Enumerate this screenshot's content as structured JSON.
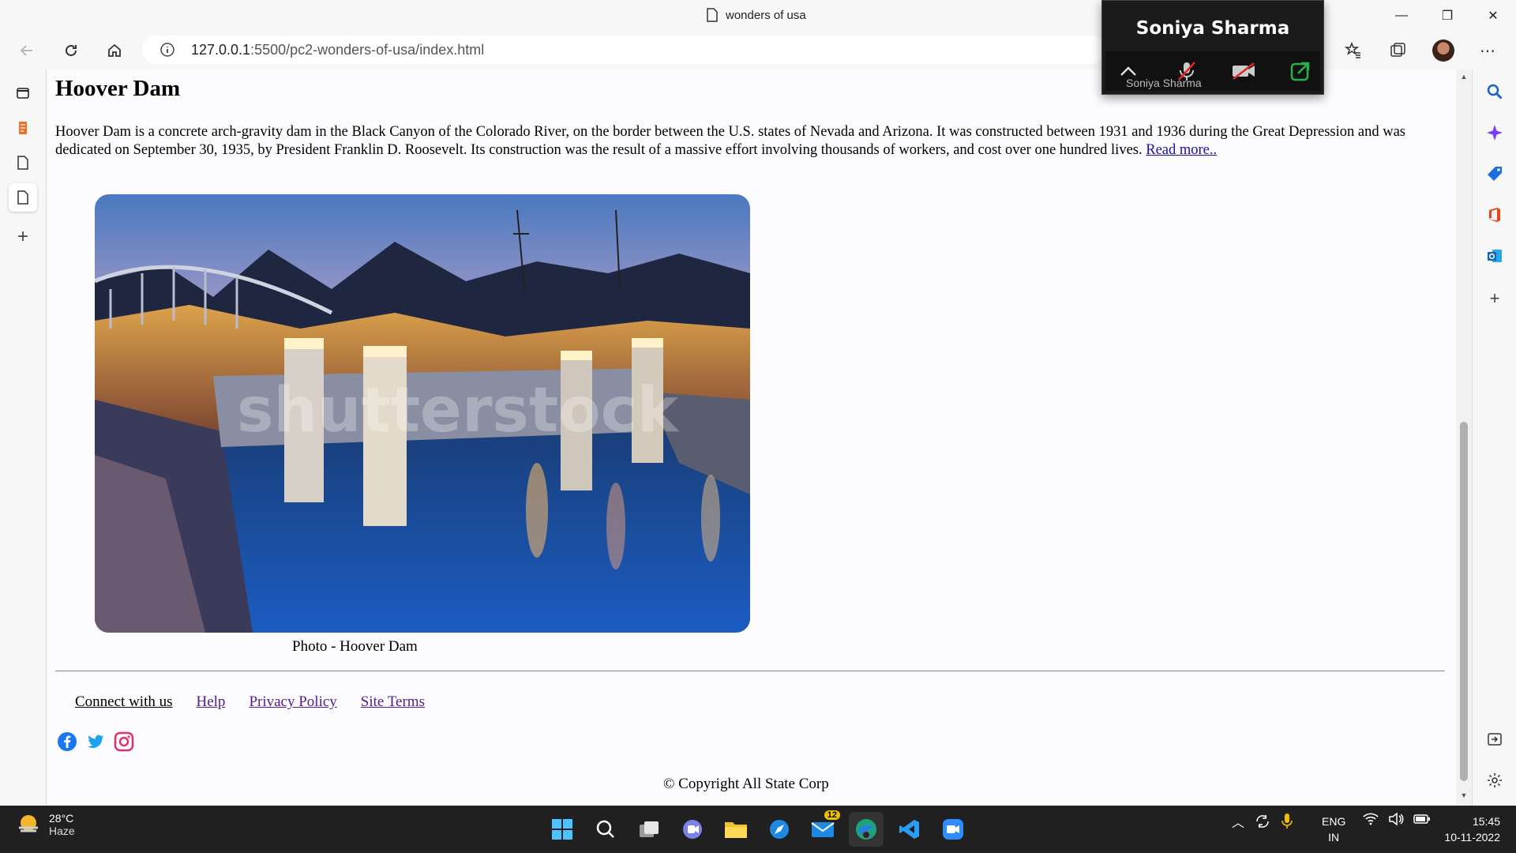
{
  "browser": {
    "tab_title": "wonders of usa",
    "url_host": "127.0.0.1",
    "url_rest": ":5500/pc2-wonders-of-usa/index.html"
  },
  "page": {
    "heading": "Hoover Dam",
    "description": "Hoover Dam is a concrete arch-gravity dam in the Black Canyon of the Colorado River, on the border between the U.S. states of Nevada and Arizona. It was constructed between 1931 and 1936 during the Great Depression and was dedicated on September 30, 1935, by President Franklin D. Roosevelt. Its construction was the result of a massive effort involving thousands of workers, and cost over one hundred lives.",
    "read_more": "Read more..",
    "photo_watermark": "shutterstock",
    "caption": "Photo - Hoover Dam",
    "footer_links": {
      "connect": "Connect with us",
      "help": "Help",
      "privacy": "Privacy Policy",
      "terms": "Site Terms"
    },
    "social_icons": [
      "facebook-icon",
      "twitter-icon",
      "instagram-icon"
    ],
    "copyright": "© Copyright All State Corp"
  },
  "zoom_overlay": {
    "name": "Soniya Sharma",
    "mini_name": "Soniya Sharma"
  },
  "taskbar": {
    "temperature": "28°C",
    "condition": "Haze",
    "mail_badge": "12",
    "lang_line1": "ENG",
    "lang_line2": "IN",
    "time": "15:45",
    "date": "10-11-2022"
  },
  "colors": {
    "link_visited": "#551a8b",
    "link": "#1a0dab",
    "taskbar_bg": "#202020"
  }
}
